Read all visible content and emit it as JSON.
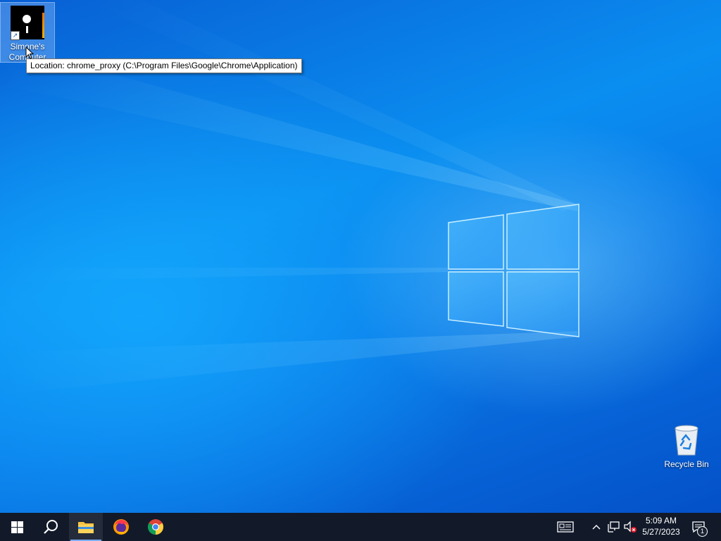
{
  "desktop": {
    "icons": [
      {
        "label": "Simone's Computer",
        "icon": "chrome-proxy-shortcut-icon",
        "selected": true
      },
      {
        "label": "Recycle Bin",
        "icon": "recycle-bin-icon",
        "selected": false
      }
    ],
    "tooltip": "Location: chrome_proxy (C:\\Program Files\\Google\\Chrome\\Application)"
  },
  "taskbar": {
    "start_icon": "windows-start-icon",
    "search_icon": "search-icon",
    "pinned": [
      {
        "name": "File Explorer",
        "icon": "file-explorer-icon",
        "active": true
      },
      {
        "name": "Firefox",
        "icon": "firefox-icon",
        "active": false
      },
      {
        "name": "Chrome",
        "icon": "chrome-icon",
        "active": false
      }
    ],
    "tray": {
      "icons": [
        "news-icon",
        "chevron-up-icon",
        "network-icon",
        "volume-muted-icon"
      ],
      "time": "5:09 AM",
      "date": "5/27/2023",
      "notification_count": "1"
    }
  },
  "colors": {
    "taskbar": "#121a2a",
    "wallpaper_blue": "#0a7ae8",
    "accent": "#7aaef5"
  }
}
